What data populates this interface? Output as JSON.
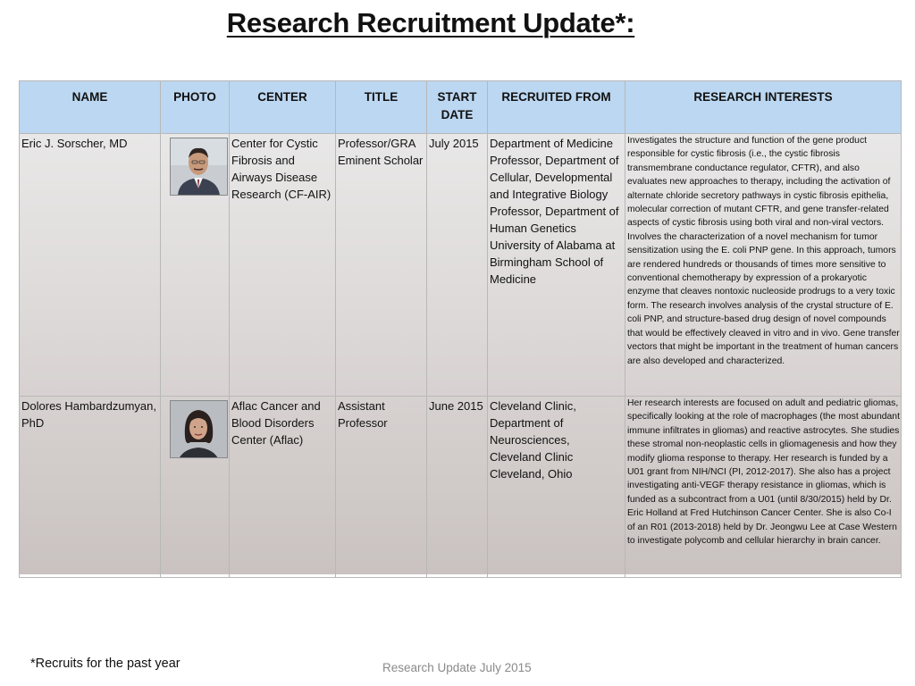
{
  "slide": {
    "title": "Research Recruitment Update*:",
    "footnote": "*Recruits for the past year",
    "footer": "Research Update July 2015"
  },
  "table": {
    "headers": {
      "name": "NAME",
      "photo": "PHOTO",
      "center": "CENTER",
      "title": "TITLE",
      "start_line1": "START",
      "start_line2": "DATE",
      "recruited_from": "RECRUITED FROM",
      "interests": "RESEARCH INTERESTS"
    },
    "rows": [
      {
        "name": "Eric J. Sorscher, MD",
        "center": "Center for Cystic Fibrosis and Airways Disease Research (CF-AIR)",
        "title": "Professor/GRA Eminent Scholar",
        "start": "July 2015",
        "recruited_from": [
          "Department of Medicine",
          "Professor, Department of Cellular, Developmental and Integrative Biology",
          "Professor, Department of Human Genetics",
          "University of Alabama at Birmingham School of Medicine"
        ],
        "interests": "Investigates the structure and function of the gene product responsible for cystic fibrosis (i.e., the cystic fibrosis transmembrane conductance regulator, CFTR), and also evaluates new approaches to therapy, including the activation of alternate chloride secretory pathways in cystic fibrosis epithelia, molecular correction of mutant CFTR, and gene transfer-related aspects of cystic fibrosis using both viral and non-viral vectors.  Involves the characterization of a novel mechanism for tumor sensitization using the E. coli PNP gene. In this approach, tumors are rendered hundreds or thousands of times more sensitive to conventional chemotherapy by expression of a prokaryotic enzyme that cleaves nontoxic nucleoside prodrugs to a very toxic form. The research involves analysis of the crystal structure of E. coli PNP, and structure-based drug design of novel compounds that would be effectively cleaved in vitro and in vivo. Gene transfer vectors that might be important in the treatment of human cancers are also developed and characterized."
      },
      {
        "name": "Dolores Hambardzumyan, PhD",
        "center": "Aflac Cancer and Blood Disorders Center (Aflac)",
        "title": "Assistant Professor",
        "start": "June 2015",
        "recruited_from": [
          "Cleveland Clinic, Department of Neurosciences, Cleveland Clinic",
          "Cleveland, Ohio"
        ],
        "interests": "Her research interests are focused on adult and pediatric gliomas, specifically looking at the role of macrophages (the most abundant immune infiltrates in gliomas) and reactive astrocytes. She studies these stromal non-neoplastic cells in gliomagenesis and how they modify glioma response to therapy. Her research is funded by a U01 grant from NIH/NCI (PI, 2012-2017). She also has a project investigating anti-VEGF therapy resistance in gliomas, which is funded as a subcontract from a U01 (until 8/30/2015) held by Dr. Eric Holland at Fred Hutchinson Cancer Center. She is also Co-I of an R01 (2013-2018) held by Dr. Jeongwu Lee at Case Western to investigate polycomb and cellular hierarchy in brain cancer."
      }
    ]
  }
}
